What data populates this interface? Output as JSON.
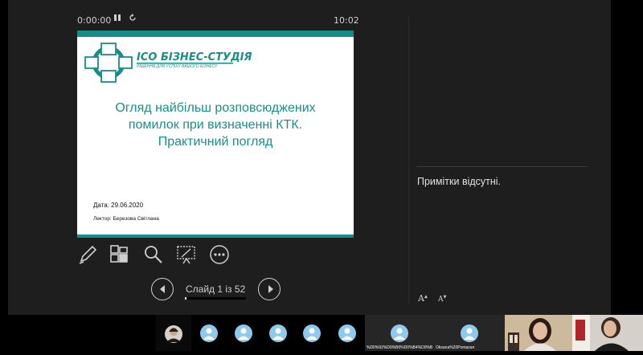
{
  "player": {
    "elapsed": "0:00:00",
    "remaining": "10:02"
  },
  "slide": {
    "logo_title": "ІСО БІЗНЕС-СТУДІЯ",
    "logo_subtitle": "РІШЕННЯ ДЛЯ УСПІХУ ВАШОГО БІЗНЕСУ",
    "title_line1": "Огляд найбільш розповсюджених",
    "title_line2": "помилок при визначенні КТК.",
    "title_line3": "Практичний погляд",
    "date": "Дата: 29.06.2020",
    "lector": "Лектор: Березова Світлана",
    "accent": "#178c88"
  },
  "toolbar": [
    "pen-icon",
    "slides-grid-icon",
    "zoom-icon",
    "subtitles-icon",
    "more-icon"
  ],
  "navigation": {
    "counter": "Слайд 1 із 52",
    "progress": 0.019
  },
  "notes": {
    "text": "Примітки відсутні."
  },
  "font_controls": {
    "increase": "A",
    "decrease": "A"
  },
  "participants": [
    {
      "kind": "video",
      "name": ""
    },
    {
      "kind": "avatar",
      "name": ""
    },
    {
      "kind": "avatar",
      "name": ""
    },
    {
      "kind": "avatar",
      "name": ""
    },
    {
      "kind": "avatar",
      "name": ""
    },
    {
      "kind": "avatar",
      "name": ""
    },
    {
      "kind": "avatar",
      "name": "%D0%92%D0%B0%D0%B4%D0%B8%D0%B8..."
    },
    {
      "kind": "avatar",
      "name": "Oksana%20Pomazan"
    },
    {
      "kind": "video",
      "name": ""
    },
    {
      "kind": "video",
      "name": ""
    }
  ]
}
